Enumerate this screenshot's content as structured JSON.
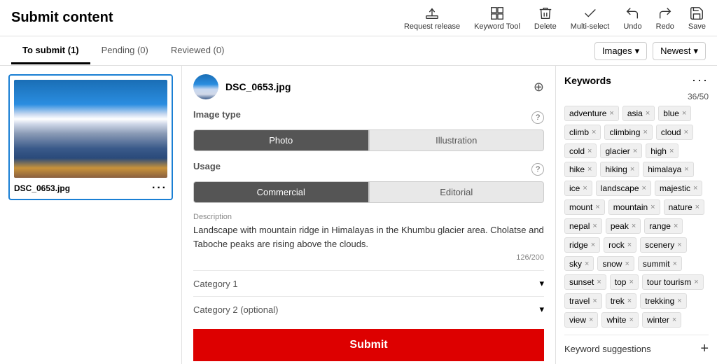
{
  "header": {
    "title": "Submit content",
    "actions": [
      {
        "id": "request-release",
        "label": "Request release",
        "icon": "upload"
      },
      {
        "id": "keyword-tool",
        "label": "Keyword Tool",
        "icon": "grid"
      },
      {
        "id": "delete",
        "label": "Delete",
        "icon": "trash"
      },
      {
        "id": "multi-select",
        "label": "Multi-select",
        "icon": "check"
      },
      {
        "id": "undo",
        "label": "Undo",
        "icon": "undo"
      },
      {
        "id": "redo",
        "label": "Redo",
        "icon": "redo"
      },
      {
        "id": "save",
        "label": "Save",
        "icon": "save"
      }
    ]
  },
  "tabs": [
    {
      "id": "to-submit",
      "label": "To submit (1)",
      "active": true
    },
    {
      "id": "pending",
      "label": "Pending (0)",
      "active": false
    },
    {
      "id": "reviewed",
      "label": "Reviewed (0)",
      "active": false
    }
  ],
  "filters": {
    "type": "Images",
    "sort": "Newest"
  },
  "image_card": {
    "filename": "DSC_0653.jpg"
  },
  "detail": {
    "filename": "DSC_0653.jpg",
    "image_type": {
      "label": "Image type",
      "options": [
        "Photo",
        "Illustration"
      ],
      "selected": "Photo"
    },
    "usage": {
      "label": "Usage",
      "options": [
        "Commercial",
        "Editorial"
      ],
      "selected": "Commercial"
    },
    "description": {
      "label": "Description",
      "text": "Landscape with mountain ridge in Himalayas in the Khumbu glacier area. Cholatse and Taboche peaks are rising above the clouds.",
      "char_count": "126/200"
    },
    "category1": {
      "label": "Category 1"
    },
    "category2": {
      "label": "Category 2 (optional)"
    },
    "submit_label": "Submit"
  },
  "keywords": {
    "title": "Keywords",
    "count": "36/50",
    "tags": [
      "adventure",
      "asia",
      "blue",
      "climb",
      "climbing",
      "cloud",
      "cold",
      "glacier",
      "high",
      "hike",
      "hiking",
      "himalaya",
      "ice",
      "landscape",
      "majestic",
      "mount",
      "mountain",
      "nature",
      "nepal",
      "peak",
      "range",
      "ridge",
      "rock",
      "scenery",
      "sky",
      "snow",
      "summit",
      "sunset",
      "top",
      "tour tourism",
      "travel",
      "trek",
      "trekking",
      "view",
      "white",
      "winter"
    ],
    "suggestions_label": "Keyword suggestions"
  }
}
